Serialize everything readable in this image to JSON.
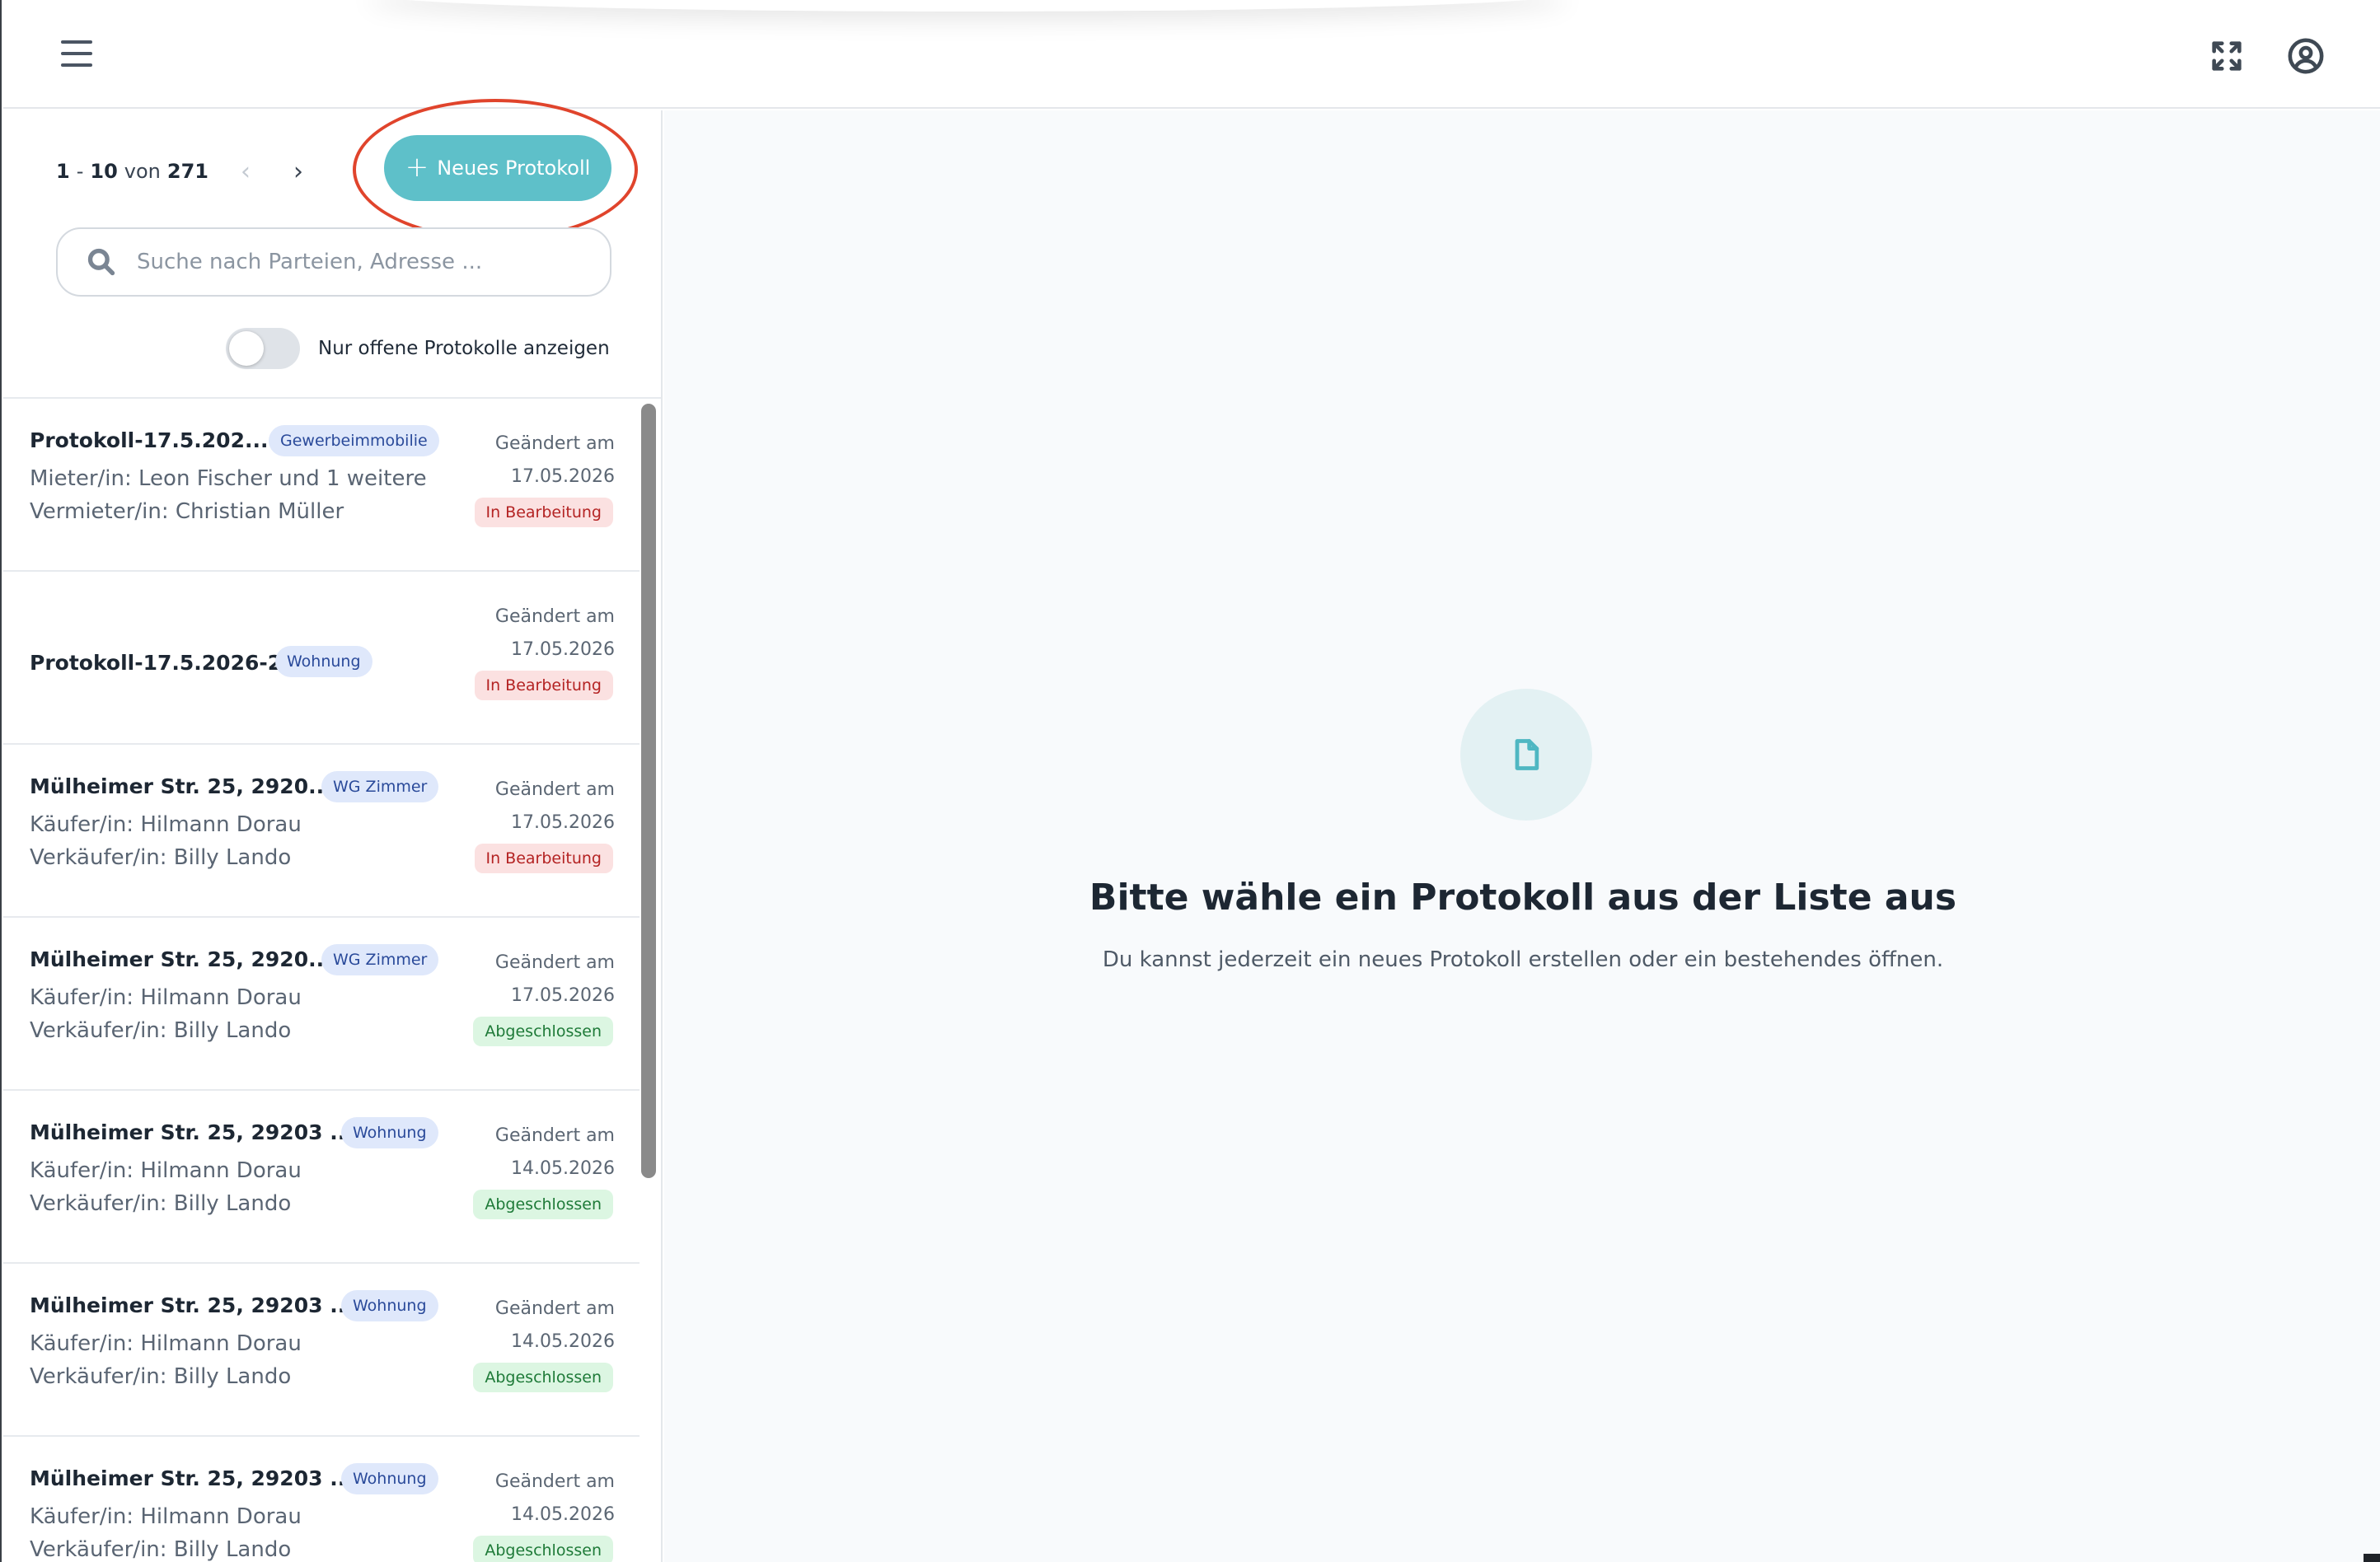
{
  "header": {
    "menu_icon": "hamburger-icon",
    "fullscreen_icon": "fullscreen-icon",
    "account_icon": "user-circle-icon"
  },
  "sidebar": {
    "pager": {
      "start": "1",
      "end": "10",
      "sep": "-",
      "word": "von",
      "total": "271"
    },
    "prev_icon": "chevron-left-icon",
    "next_icon": "chevron-right-icon",
    "new_button": {
      "plus": "+",
      "label": "Neues Protokoll"
    },
    "search": {
      "placeholder": "Suche nach Parteien, Adresse ..."
    },
    "toggle_label": "Nur offene Protokolle anzeigen",
    "items": [
      {
        "title": "Protokoll-17.5.202...",
        "type": "Gewerbeimmobilie",
        "line1": "Mieter/in: Leon Fischer und 1 weitere",
        "line2": "Vermieter/in: Christian Müller",
        "changed": "Geändert am",
        "date": "17.05.2026",
        "status": "In Bearbeitung"
      },
      {
        "title": "Protokoll-17.5.2026-2",
        "type": "Wohnung",
        "line1": "",
        "line2": "",
        "changed": "Geändert am",
        "date": "17.05.2026",
        "status": "In Bearbeitung"
      },
      {
        "title": "Mülheimer Str. 25, 2920...",
        "type": "WG Zimmer",
        "line1": "Käufer/in: Hilmann Dorau",
        "line2": "Verkäufer/in: Billy Lando",
        "changed": "Geändert am",
        "date": "17.05.2026",
        "status": "In Bearbeitung"
      },
      {
        "title": "Mülheimer Str. 25, 2920...",
        "type": "WG Zimmer",
        "line1": "Käufer/in: Hilmann Dorau",
        "line2": "Verkäufer/in: Billy Lando",
        "changed": "Geändert am",
        "date": "17.05.2026",
        "status": "Abgeschlossen"
      },
      {
        "title": "Mülheimer Str. 25, 29203 ...",
        "type": "Wohnung",
        "line1": "Käufer/in: Hilmann Dorau",
        "line2": "Verkäufer/in: Billy Lando",
        "changed": "Geändert am",
        "date": "14.05.2026",
        "status": "Abgeschlossen"
      },
      {
        "title": "Mülheimer Str. 25, 29203 ...",
        "type": "Wohnung",
        "line1": "Käufer/in: Hilmann Dorau",
        "line2": "Verkäufer/in: Billy Lando",
        "changed": "Geändert am",
        "date": "14.05.2026",
        "status": "Abgeschlossen"
      },
      {
        "title": "Mülheimer Str. 25, 29203 ...",
        "type": "Wohnung",
        "line1": "Käufer/in: Hilmann Dorau",
        "line2": "Verkäufer/in: Billy Lando",
        "changed": "Geändert am",
        "date": "14.05.2026",
        "status": "Abgeschlossen"
      }
    ]
  },
  "main": {
    "empty_icon": "document-icon",
    "empty_title": "Bitte wähle ein Protokoll aus der Liste aus",
    "empty_subtitle": "Du kannst jederzeit ein neues Protokoll erstellen oder ein bestehendes öffnen."
  },
  "colors": {
    "accent": "#5ec0c9",
    "highlight_ring": "#e0442c",
    "status_open_bg": "#fbe1e1",
    "status_open_text": "#b42323",
    "status_done_bg": "#dcf6e2",
    "status_done_text": "#1e7a38",
    "type_badge_bg": "#dfe8fb"
  }
}
